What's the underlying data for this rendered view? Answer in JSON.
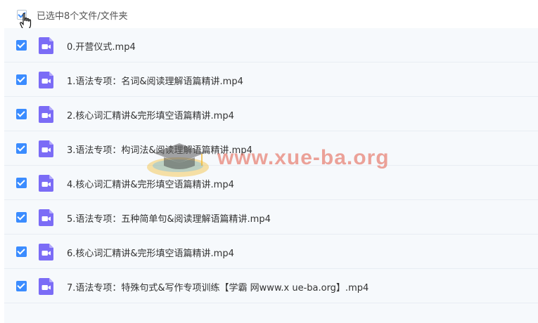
{
  "header": {
    "selected_text": "已选中8个文件/文件夹"
  },
  "files": [
    {
      "name": "0.开营仪式.mp4",
      "icon": "video-file-icon",
      "checked": true
    },
    {
      "name": "1.语法专项：名词&阅读理解语篇精讲.mp4",
      "icon": "video-file-icon",
      "checked": true
    },
    {
      "name": "2.核心词汇精讲&完形填空语篇精讲.mp4",
      "icon": "video-file-icon",
      "checked": true
    },
    {
      "name": "3.语法专项：构词法&阅读理解语篇精讲.mp4",
      "icon": "video-file-icon",
      "checked": true
    },
    {
      "name": "4.核心词汇精讲&完形填空语篇精讲.mp4",
      "icon": "video-file-icon",
      "checked": true
    },
    {
      "name": "5.语法专项：五种简单句&阅读理解语篇精讲.mp4",
      "icon": "video-file-icon",
      "checked": true
    },
    {
      "name": "6.核心词汇精讲&完形填空语篇精讲.mp4",
      "icon": "video-file-icon",
      "checked": true
    },
    {
      "name": "7.语法专项：特殊句式&写作专项训练【学霸 网www.x ue-ba.org】.mp4",
      "icon": "video-file-icon",
      "checked": true
    }
  ],
  "watermark": {
    "text": "www.xue-ba.org"
  },
  "colors": {
    "accent": "#3b8cff",
    "file_icon": "#7b6cf6",
    "row_bg": "#f6f9fc"
  }
}
